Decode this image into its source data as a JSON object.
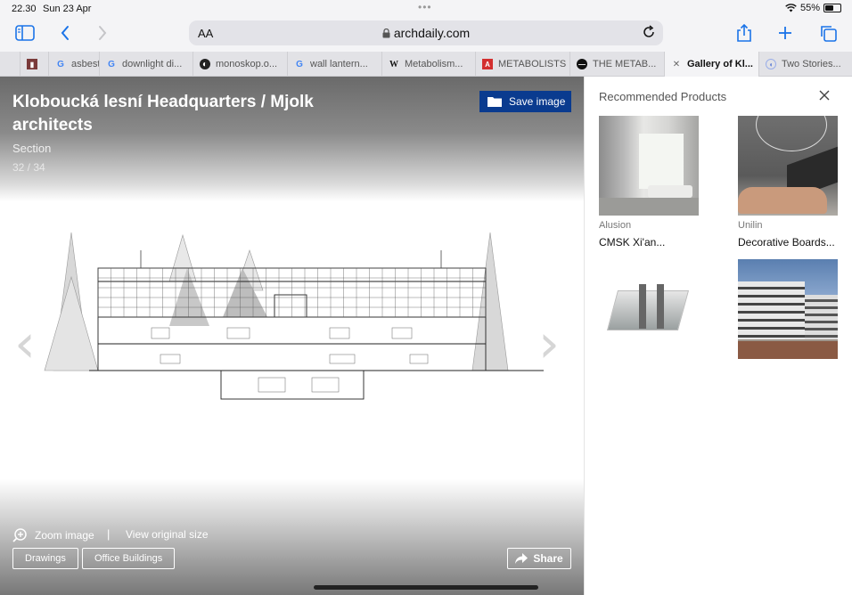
{
  "status": {
    "time": "22.30",
    "date": "Sun 23 Apr",
    "battery": "55%",
    "battery_level": 0.55
  },
  "toolbar": {
    "text_size_label": "AA",
    "url": "archdaily.com"
  },
  "tabs": [
    {
      "label": "asbest",
      "icon": "google-icon"
    },
    {
      "label": "downlight di...",
      "icon": "google-icon"
    },
    {
      "label": "monoskop.o...",
      "icon": "monoskop-icon"
    },
    {
      "label": "wall lantern...",
      "icon": "google-icon"
    },
    {
      "label": "Metabolism...",
      "icon": "wikipedia-icon"
    },
    {
      "label": "METABOLISTS",
      "icon": "pdf-icon"
    },
    {
      "label": "THE METAB...",
      "icon": "site-icon"
    },
    {
      "label": "Gallery of Kl...",
      "icon": "close-icon"
    },
    {
      "label": "Two Stories...",
      "icon": "site-icon"
    }
  ],
  "gallery": {
    "title": "Kloboucká lesní Headquarters / Mjolk architects",
    "caption": "Section",
    "counter": "32 / 34",
    "save_label": "Save image",
    "zoom_label": "Zoom image",
    "separator": "|",
    "view_original_label": "View original size",
    "tags": [
      "Drawings",
      "Office Buildings"
    ],
    "share_label": "Share"
  },
  "sidebar": {
    "heading": "Recommended Products",
    "products": [
      {
        "brand": "Alusion",
        "name": "CMSK Xi'an..."
      },
      {
        "brand": "Unilin",
        "name": "Decorative Boards..."
      },
      {
        "brand": "",
        "name": ""
      },
      {
        "brand": "",
        "name": ""
      }
    ]
  }
}
